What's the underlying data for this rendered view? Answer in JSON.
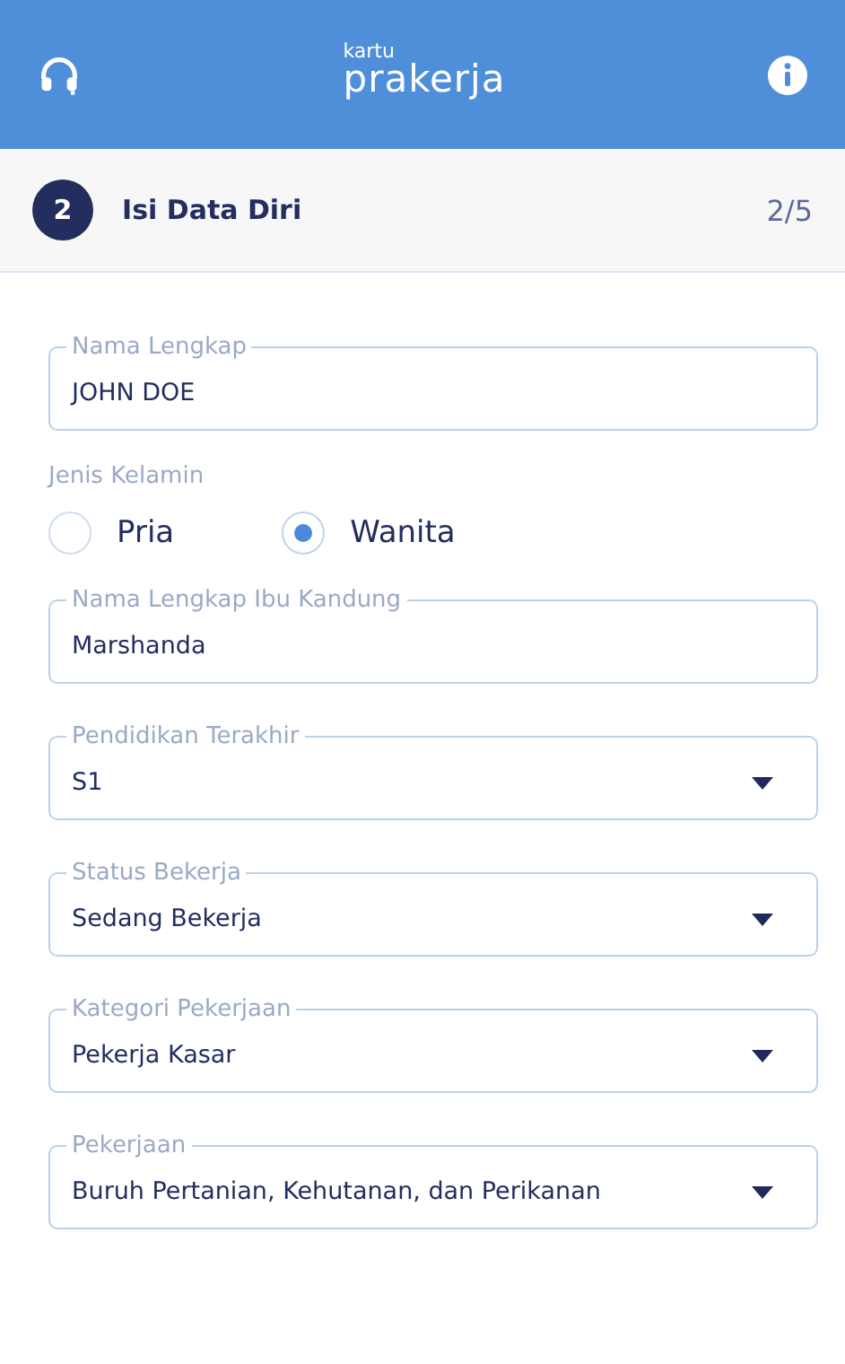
{
  "header": {
    "logo_small": "kartu",
    "logo_main": "prakerja"
  },
  "step": {
    "number": "2",
    "title": "Isi Data Diri",
    "progress": "2/5"
  },
  "fields": [
    {
      "kind": "text",
      "label": "Nama Lengkap",
      "value": "JOHN DOE"
    },
    {
      "kind": "radio",
      "label": "Jenis Kelamin",
      "options": [
        {
          "label": "Pria",
          "selected": false
        },
        {
          "label": "Wanita",
          "selected": true
        }
      ]
    },
    {
      "kind": "text",
      "label": "Nama Lengkap Ibu Kandung",
      "value": "Marshanda"
    },
    {
      "kind": "select",
      "label": "Pendidikan Terakhir",
      "value": "S1"
    },
    {
      "kind": "select",
      "label": "Status Bekerja",
      "value": "Sedang Bekerja"
    },
    {
      "kind": "select",
      "label": "Kategori Pekerjaan",
      "value": "Pekerja Kasar"
    },
    {
      "kind": "select",
      "label": "Pekerjaan",
      "value": "Buruh Pertanian, Kehutanan, dan Perikanan"
    }
  ]
}
